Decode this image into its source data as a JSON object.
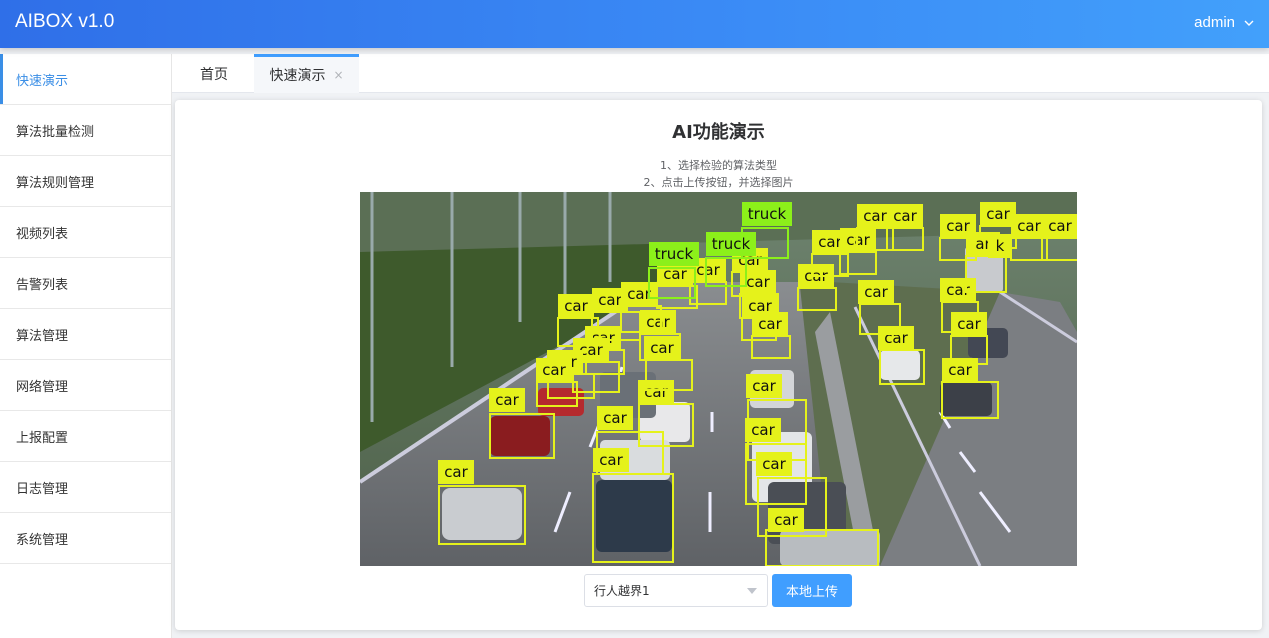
{
  "app": {
    "title": "AIBOX v1.0",
    "user": "admin"
  },
  "sidebar": {
    "items": [
      {
        "label": "快速演示"
      },
      {
        "label": "算法批量检测"
      },
      {
        "label": "算法规则管理"
      },
      {
        "label": "视频列表"
      },
      {
        "label": "告警列表"
      },
      {
        "label": "算法管理"
      },
      {
        "label": "网络管理"
      },
      {
        "label": "上报配置"
      },
      {
        "label": "日志管理"
      },
      {
        "label": "系统管理"
      }
    ]
  },
  "tabs": {
    "home": "首页",
    "demo": "快速演示",
    "close": "×"
  },
  "main": {
    "title": "AI功能演示",
    "step1": "1、选择检验的算法类型",
    "step2": "2、点击上传按钮，并选择图片",
    "select_value": "行人越界1",
    "upload_label": "本地上传"
  },
  "colors": {
    "accent": "#409eff",
    "header_start": "#2f6fe8",
    "header_end": "#42a0fb",
    "detect_car": "#e5f21b",
    "detect_truck": "#8cf01a"
  },
  "detections": {
    "labels": [
      "car",
      "car",
      "car",
      "car",
      "car",
      "car",
      "car",
      "car",
      "car",
      "car",
      "car",
      "car",
      "car",
      "car",
      "car",
      "car",
      "car",
      "car",
      "car",
      "car",
      "car",
      "car",
      "car",
      "car",
      "car",
      "car",
      "car",
      "car",
      "car",
      "car",
      "car",
      "car",
      "car",
      "car",
      "car",
      "car",
      "car",
      "car",
      "car",
      "truck",
      "truck",
      "truck",
      "ar",
      "k"
    ]
  }
}
